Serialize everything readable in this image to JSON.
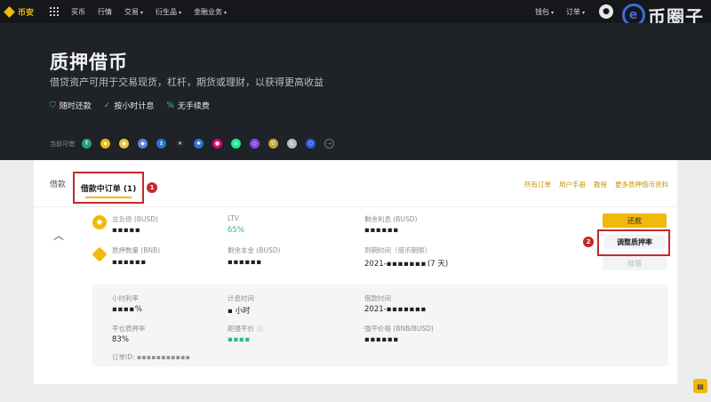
{
  "nav": {
    "logo": "币安",
    "items": [
      {
        "label": "买币",
        "caret": ""
      },
      {
        "label": "行情",
        "caret": ""
      },
      {
        "label": "交易",
        "caret": "▾"
      },
      {
        "label": "衍生品",
        "caret": "▾"
      },
      {
        "label": "金融业务",
        "caret": "▾"
      }
    ],
    "right_items": [
      {
        "label": "钱包",
        "caret": "▾"
      },
      {
        "label": "订单",
        "caret": "▾"
      }
    ],
    "watermark": "币圈子"
  },
  "hero": {
    "title": "质押借币",
    "subtitle": "借贷资产可用于交易现货，杠杆，期货或理财，以获得更高收益",
    "features": [
      "随时还款",
      "按小时计息",
      "无手续费"
    ],
    "coins_label": "当前可借",
    "coins": [
      {
        "icon": "usdt-icon",
        "glyph": "₮",
        "color": "#26a17b"
      },
      {
        "icon": "busd-icon",
        "glyph": "◆",
        "color": "#f0b90b"
      },
      {
        "icon": "bnb-icon",
        "glyph": "◆",
        "color": "#e6c44a"
      },
      {
        "icon": "eth-icon",
        "glyph": "◆",
        "color": "#627eea"
      },
      {
        "icon": "usdc-icon",
        "glyph": "$",
        "color": "#2775ca"
      },
      {
        "icon": "xrp-icon",
        "glyph": "✕",
        "color": "#23292f"
      },
      {
        "icon": "ada-icon",
        "glyph": "✱",
        "color": "#2a71d0"
      },
      {
        "icon": "dot-icon",
        "glyph": "●",
        "color": "#e6007a"
      },
      {
        "icon": "sol-icon",
        "glyph": "≡",
        "color": "#14f195"
      },
      {
        "icon": "matic-icon",
        "glyph": "◇",
        "color": "#8247e5"
      },
      {
        "icon": "doge-icon",
        "glyph": "Ð",
        "color": "#c2a633"
      },
      {
        "icon": "ltc-icon",
        "glyph": "Ł",
        "color": "#bfbbbb"
      },
      {
        "icon": "link-icon",
        "glyph": "⬡",
        "color": "#2a5ada"
      }
    ],
    "more_glyph": "→"
  },
  "tabs": {
    "borrow": "借款",
    "ongoing": "借款中订单 (1)",
    "links": [
      "所有订单",
      "用户手册",
      "教程",
      "更多质押借币资料"
    ]
  },
  "annotations": {
    "badge1": "1",
    "badge2": "2"
  },
  "order": {
    "total_debt_label": "总负债 (BUSD)",
    "total_debt_value": "▪ ▪ ▪ ▪ ▪",
    "ltv_label": "LTV",
    "ltv_value": "65%",
    "remaining_interest_label": "剩余利息 (BUSD)",
    "remaining_interest_value": "▪ ▪ ▪ ▪ ▪ ▪",
    "collateral_label": "质押数量 (BNB)",
    "collateral_value": "▪ ▪ ▪ ▪ ▪ ▪",
    "remaining_principal_label": "剩余本金 (BUSD)",
    "remaining_principal_value": "▪ ▪ ▪ ▪ ▪ ▪",
    "expiry_label": "到期时间（借币期限）",
    "expiry_prefix": "2021-",
    "expiry_blur": "▪ ▪ ▪ ▪ ▪ ▪ ▪",
    "expiry_suffix": "(7 天)",
    "hourly_rate_label": "小时利率",
    "hourly_rate_value": "▪ ▪ ▪ ▪ %",
    "interest_time_label": "计息时间",
    "interest_time_value": "▪ 小时",
    "borrow_time_label": "借款时间",
    "borrow_time_prefix": "2021-",
    "borrow_time_blur": "▪ ▪ ▪ ▪ ▪ ▪ ▪",
    "close_ratio_label": "平仓质押率",
    "close_ratio_value": "83%",
    "liq_price_label": "距强平价",
    "liq_price_info": "ⓘ",
    "liq_price_value": "▪ ▪ ▪ ▪",
    "force_price_label": "强平价格 (BNB/BUSD)",
    "force_price_value": "▪ ▪ ▪ ▪ ▪ ▪",
    "order_id_label": "订单ID:",
    "order_id_value": "▪ ▪ ▪ ▪ ▪ ▪ ▪ ▪ ▪ ▪ ▪"
  },
  "buttons": {
    "repay": "还款",
    "adjust": "调整质押率",
    "renew": "续借"
  }
}
